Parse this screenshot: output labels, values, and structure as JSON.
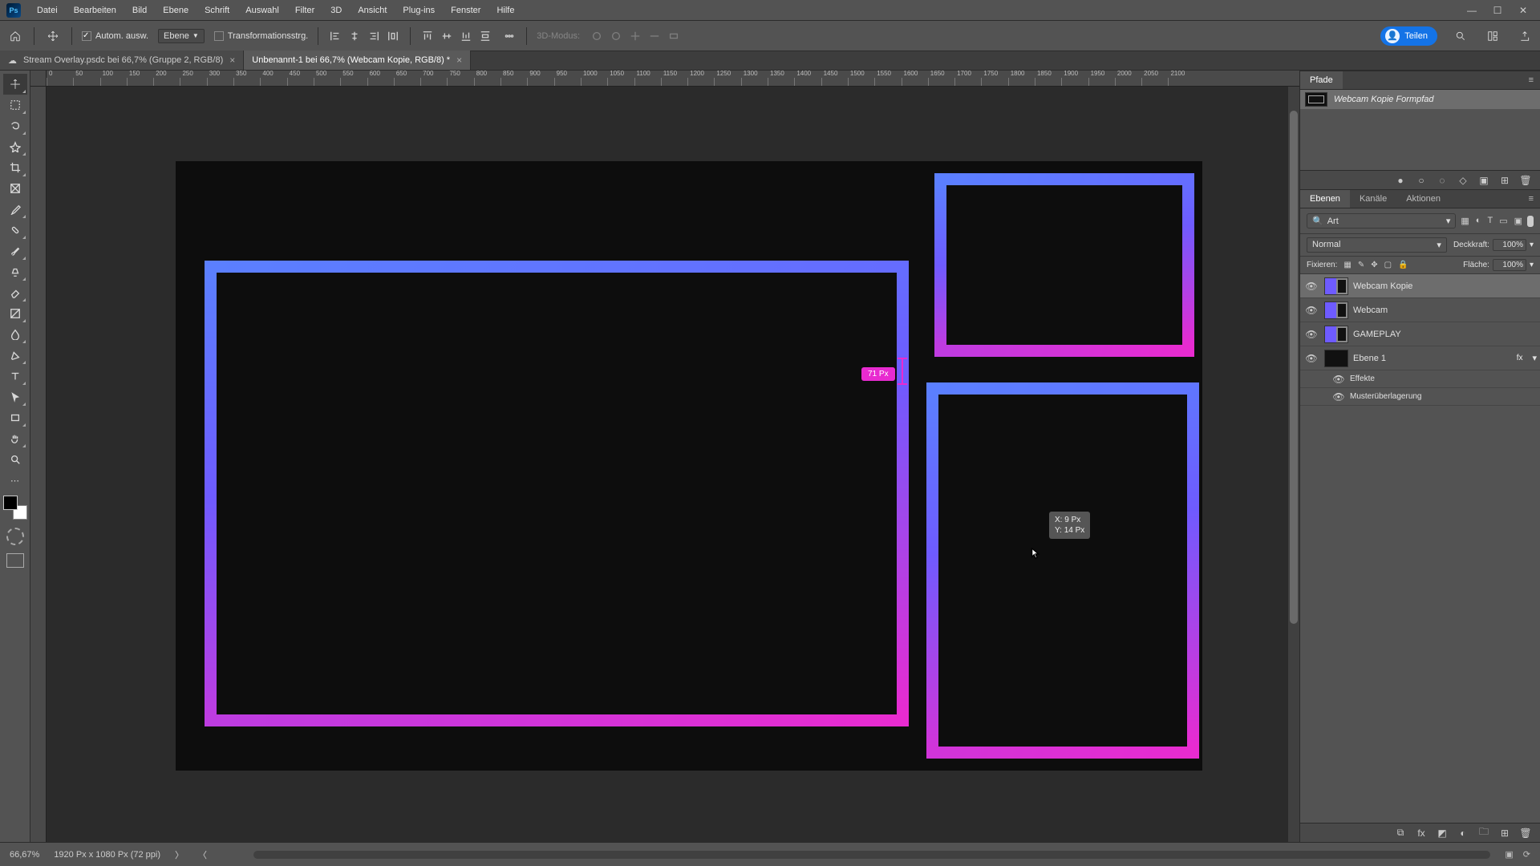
{
  "menu": [
    "Datei",
    "Bearbeiten",
    "Bild",
    "Ebene",
    "Schrift",
    "Auswahl",
    "Filter",
    "3D",
    "Ansicht",
    "Plug-ins",
    "Fenster",
    "Hilfe"
  ],
  "options": {
    "auto_select": "Autom. ausw.",
    "target": "Ebene",
    "transform": "Transformationsstrg.",
    "mode3d": "3D-Modus:"
  },
  "share": "Teilen",
  "tabs": [
    {
      "label": "Stream Overlay.psdc bei 66,7% (Gruppe 2, RGB/8)",
      "cloud": true,
      "active": false
    },
    {
      "label": "Unbenannt-1 bei 66,7% (Webcam Kopie, RGB/8) *",
      "cloud": false,
      "active": true
    }
  ],
  "ruler_ticks": [
    "0",
    "50",
    "100",
    "150",
    "200",
    "250",
    "300",
    "350",
    "400",
    "450",
    "500",
    "550",
    "600",
    "650",
    "700",
    "750",
    "800",
    "850",
    "900",
    "950",
    "1000",
    "1050",
    "1100",
    "1150",
    "1200",
    "1250",
    "1300",
    "1350",
    "1400",
    "1450",
    "1500",
    "1550",
    "1600",
    "1650",
    "1700",
    "1750",
    "1800",
    "1850",
    "1900",
    "1950",
    "2000",
    "2050",
    "2100"
  ],
  "measure_pill": "71 Px",
  "position_tooltip": {
    "dx_label": "X:",
    "dx": "9 Px",
    "dy_label": "Y:",
    "dy": "14 Px"
  },
  "paths": {
    "title": "Pfade",
    "item": "Webcam Kopie Formpfad"
  },
  "layers_panel": {
    "tabs": [
      "Ebenen",
      "Kanäle",
      "Aktionen"
    ],
    "filter_kind": "Art",
    "blend_mode": "Normal",
    "opacity_label": "Deckkraft:",
    "opacity": "100%",
    "lock_label": "Fixieren:",
    "fill_label": "Fläche:",
    "fill": "100%",
    "layers": [
      {
        "name": "Webcam Kopie",
        "selected": true,
        "shape": true
      },
      {
        "name": "Webcam",
        "selected": false,
        "shape": true
      },
      {
        "name": "GAMEPLAY",
        "selected": false,
        "shape": true
      },
      {
        "name": "Ebene 1",
        "selected": false,
        "shape": false,
        "fx": "fx"
      }
    ],
    "effects_label": "Effekte",
    "effect1": "Musterüberlagerung"
  },
  "status": {
    "zoom": "66,67%",
    "doc_info": "1920 Px x 1080 Px (72 ppi)"
  }
}
